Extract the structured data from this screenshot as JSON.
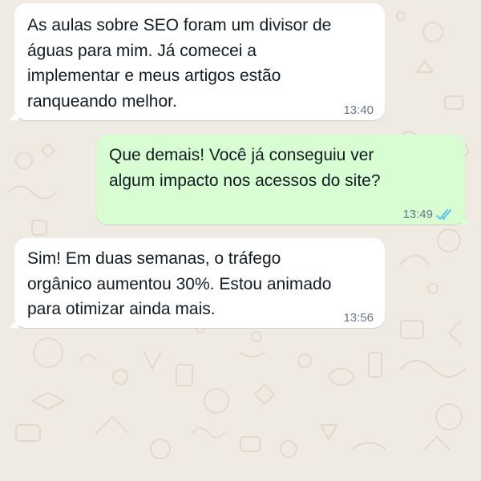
{
  "colors": {
    "background": "#efeae2",
    "incoming_bubble": "#ffffff",
    "outgoing_bubble": "#d9fdd3",
    "text": "#111b21",
    "timestamp": "#667781",
    "read_receipt": "#53bdeb"
  },
  "messages": [
    {
      "direction": "incoming",
      "text": "As aulas sobre SEO foram um divisor de\náguas para mim. Já comecei a\nimplementar e meus artigos estão\nranqueando melhor.",
      "time": "13:40"
    },
    {
      "direction": "outgoing",
      "text": "Que demais! Você já conseguiu ver\nalgum impacto nos acessos do site?",
      "time": "13:49",
      "status_icon": "double-check-read-icon"
    },
    {
      "direction": "incoming",
      "text": "Sim! Em duas semanas, o tráfego\norgânico aumentou 30%. Estou animado\npara otimizar ainda mais.",
      "time": "13:56"
    }
  ]
}
